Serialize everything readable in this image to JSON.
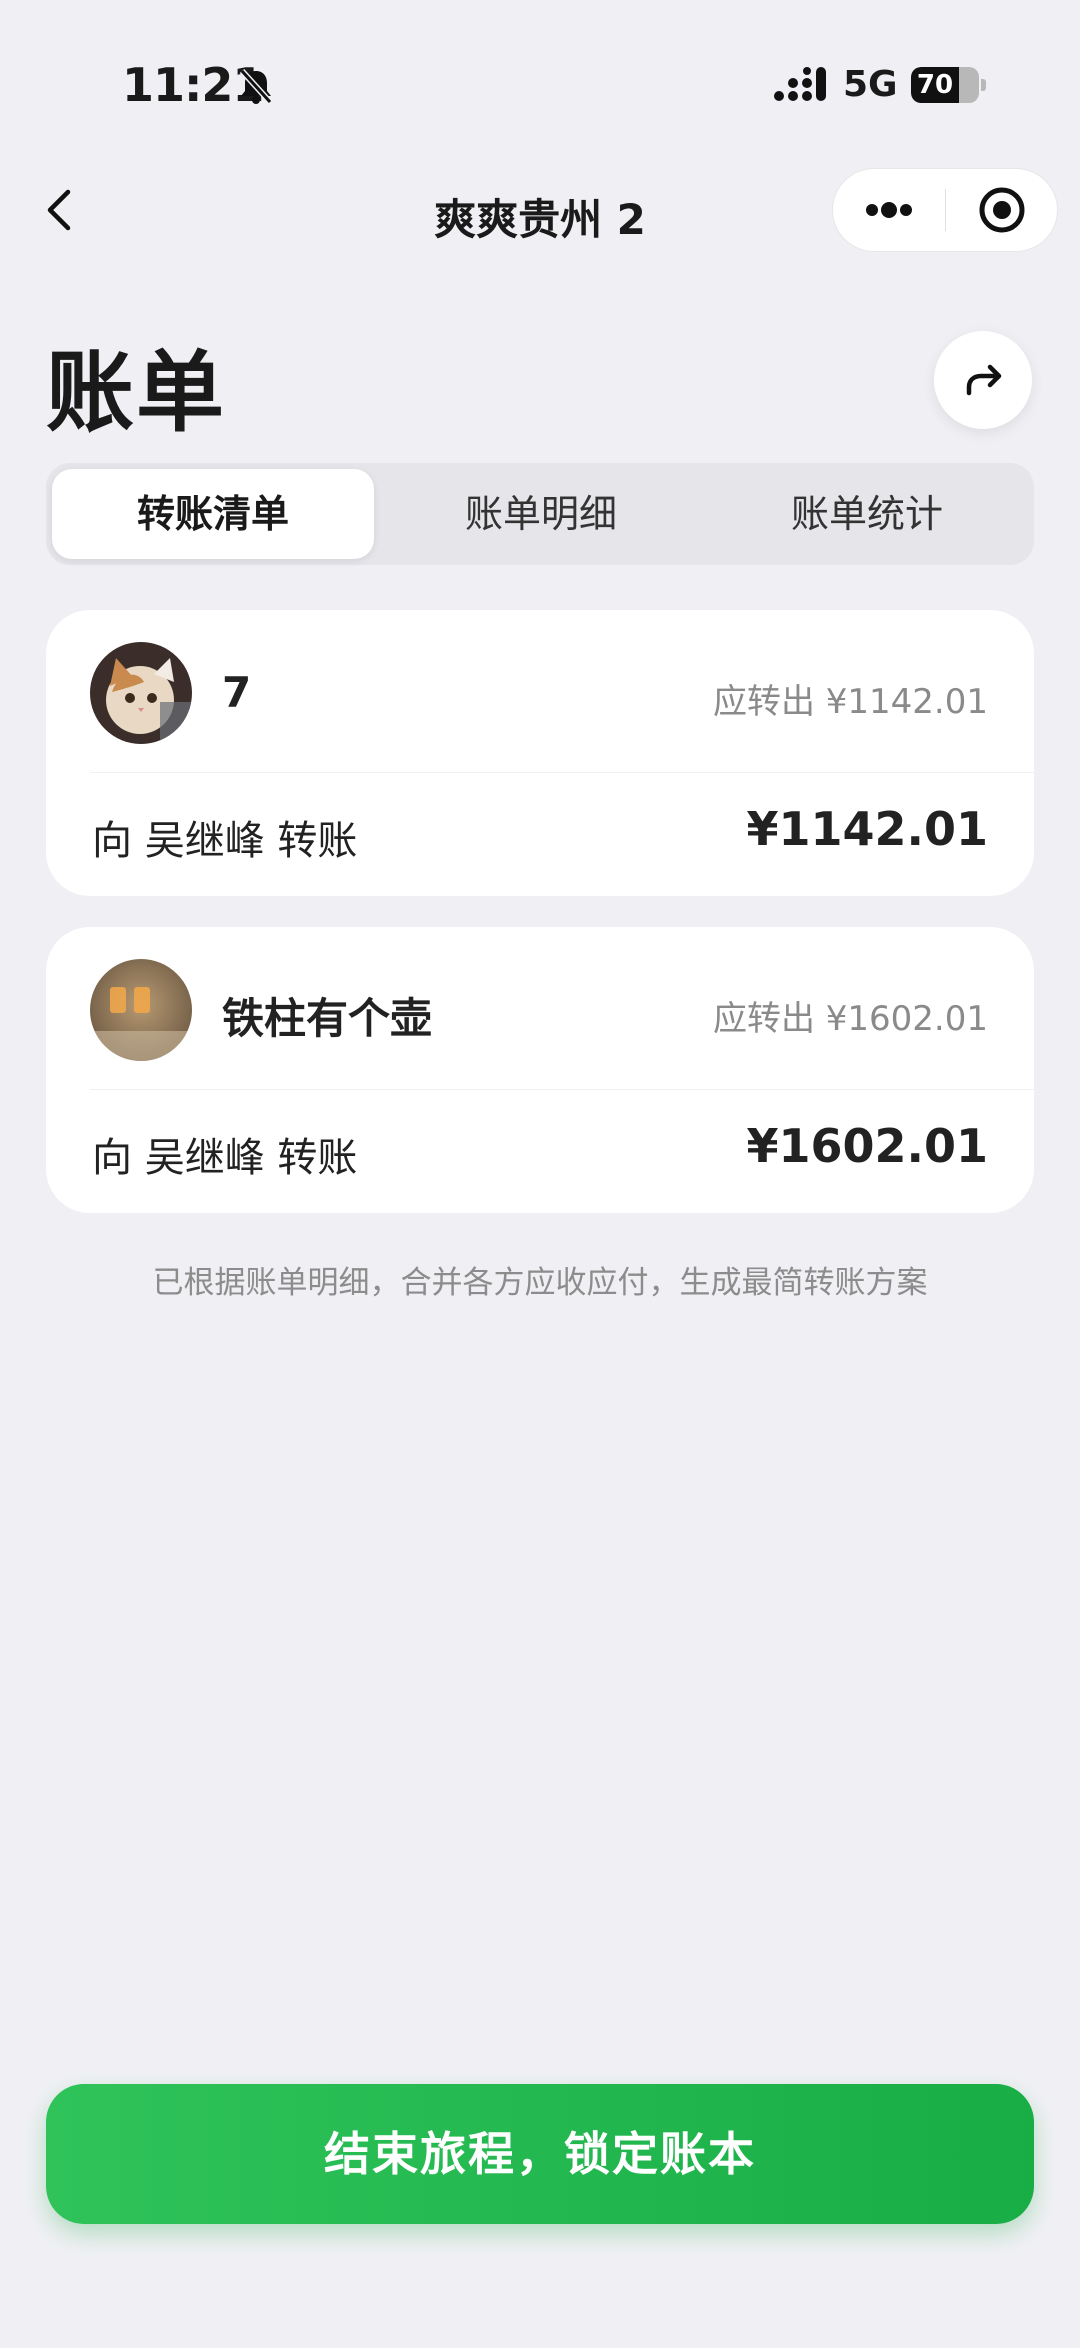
{
  "status_bar": {
    "time": "11:21",
    "network": "5G",
    "battery": "70",
    "battery_level": 0.7
  },
  "nav": {
    "title": "爽爽贵州 2"
  },
  "header": {
    "title": "账单"
  },
  "tabs": [
    {
      "label": "转账清单",
      "active": true
    },
    {
      "label": "账单明细",
      "active": false
    },
    {
      "label": "账单统计",
      "active": false
    }
  ],
  "transfers": [
    {
      "payer": "7",
      "due": "应转出 ¥1142.01",
      "description": "向 吴继峰 转账",
      "amount": "¥1142.01"
    },
    {
      "payer": "铁柱有个壶",
      "due": "应转出 ¥1602.01",
      "description": "向 吴继峰 转账",
      "amount": "¥1602.01"
    }
  ],
  "footnote": "已根据账单明细，合并各方应收应付，生成最简转账方案",
  "primary_action": "结束旅程，锁定账本",
  "colors": {
    "accent_green": "#1fb64e",
    "background": "#f0f0f4"
  },
  "icons": [
    "back-icon",
    "more-icon",
    "close-mini-icon",
    "share-icon",
    "bell-slash-icon",
    "signal-icon"
  ]
}
